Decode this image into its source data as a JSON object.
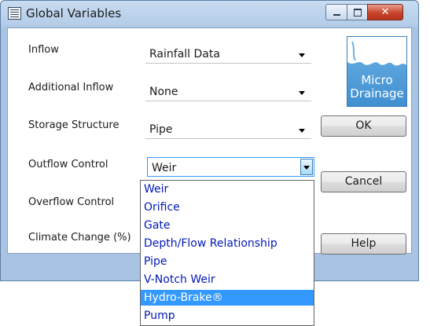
{
  "window": {
    "title": "Global Variables",
    "close_glyph": "✕"
  },
  "form": {
    "inflow": {
      "label": "Inflow",
      "value": "Rainfall Data"
    },
    "additional_inflow": {
      "label": "Additional Inflow",
      "value": "None"
    },
    "storage_structure": {
      "label": "Storage Structure",
      "value": "Pipe"
    },
    "outflow_control": {
      "label": "Outflow Control",
      "value": "Weir"
    },
    "overflow_control": {
      "label": "Overflow Control"
    },
    "climate_change": {
      "label": "Climate Change (%)"
    }
  },
  "buttons": {
    "ok": "OK",
    "cancel": "Cancel",
    "help": "Help"
  },
  "logo": {
    "line1": "Micro",
    "line2": "Drainage"
  },
  "dropdown": {
    "items": [
      "Weir",
      "Orifice",
      "Gate",
      "Depth/Flow Relationship",
      "Pipe",
      "V-Notch Weir",
      "Hydro-Brake®",
      "Pump"
    ],
    "selected": "Hydro-Brake®"
  },
  "colors": {
    "title_bar": "#b5cde8",
    "selection": "#3399ff",
    "list_text": "#0018b5"
  },
  "icons": {
    "app": "window-list-icon",
    "minimize": "minimize-icon",
    "maximize": "maximize-icon",
    "close": "close-icon",
    "dropdown": "chevron-down-icon"
  }
}
